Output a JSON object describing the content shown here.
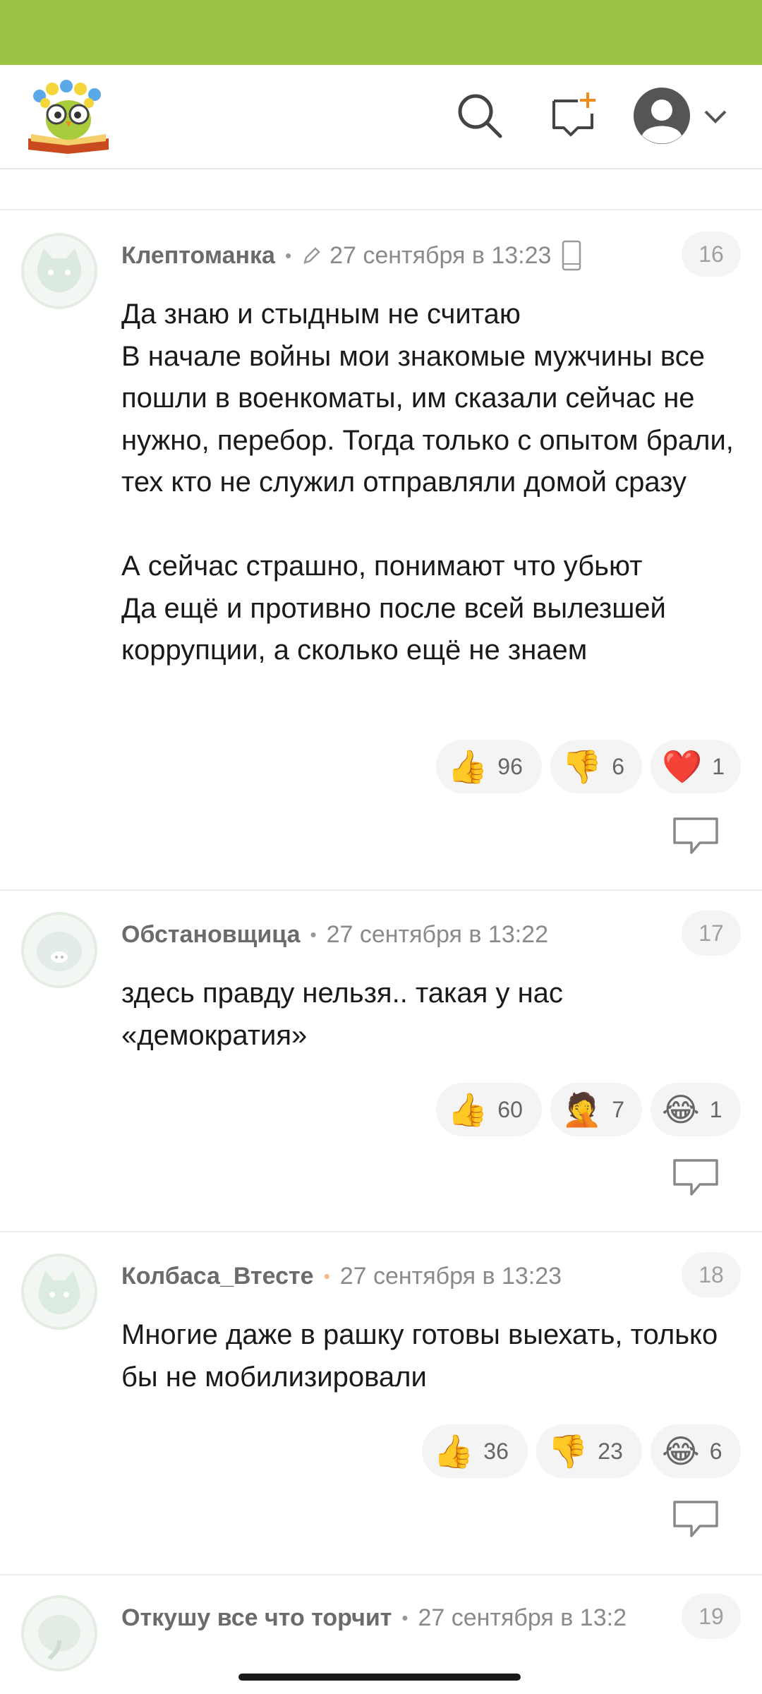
{
  "colors": {
    "accent": "#9dc244",
    "badge_bg": "#f4f4f4",
    "meta_text": "#8a8a8a"
  },
  "header": {
    "logo_icon": "owl-on-book-logo",
    "search_icon": "search-icon",
    "new_post_icon": "new-message-plus-icon",
    "avatar_icon": "user-avatar-icon",
    "menu_icon": "chevron-down-icon"
  },
  "comments": [
    {
      "author": "Клептоманка",
      "date": "27 сентября в 13:23",
      "edited": true,
      "device": "phone",
      "number": "16",
      "text": "Да знаю и стыдным не считаю\nВ начале войны мои знакомые мужчины все пошли в военкоматы, им сказали сейчас не нужно, перебор. Тогда только с опытом брали, тех кто не служил отправляли домой сразу\n\nА сейчас страшно, понимают что убьют\nДа ещё и противно после всей вылезшей коррупции, а сколько ещё не знаем",
      "reactions": [
        {
          "emoji": "👍",
          "icon": "thumbs-up-icon",
          "count": "96"
        },
        {
          "emoji": "👎",
          "icon": "thumbs-down-icon",
          "count": "6"
        },
        {
          "emoji": "❤️",
          "icon": "heart-icon",
          "count": "1"
        }
      ]
    },
    {
      "author": "Обстановщица",
      "date": "27 сентября в 13:22",
      "number": "17",
      "text": "здесь правду нельзя.. такая у нас «демократия»",
      "reactions": [
        {
          "emoji": "👍",
          "icon": "thumbs-up-icon",
          "count": "60"
        },
        {
          "emoji": "🤦",
          "icon": "facepalm-icon",
          "count": "7"
        },
        {
          "emoji": "😂",
          "icon": "tears-of-joy-icon",
          "count": "1"
        }
      ]
    },
    {
      "author": "Колбаса_Втесте",
      "date": "27 сентября в 13:23",
      "number": "18",
      "text": "Многие даже в рашку готовы выехать, только бы не мобилизировали",
      "reactions": [
        {
          "emoji": "👍",
          "icon": "thumbs-up-icon",
          "count": "36"
        },
        {
          "emoji": "👎",
          "icon": "thumbs-down-icon",
          "count": "23"
        },
        {
          "emoji": "😂",
          "icon": "tears-of-joy-icon",
          "count": "6"
        }
      ]
    },
    {
      "author": "Откушу все что торчит",
      "date": "27 сентября в 13:2",
      "number": "19"
    }
  ]
}
